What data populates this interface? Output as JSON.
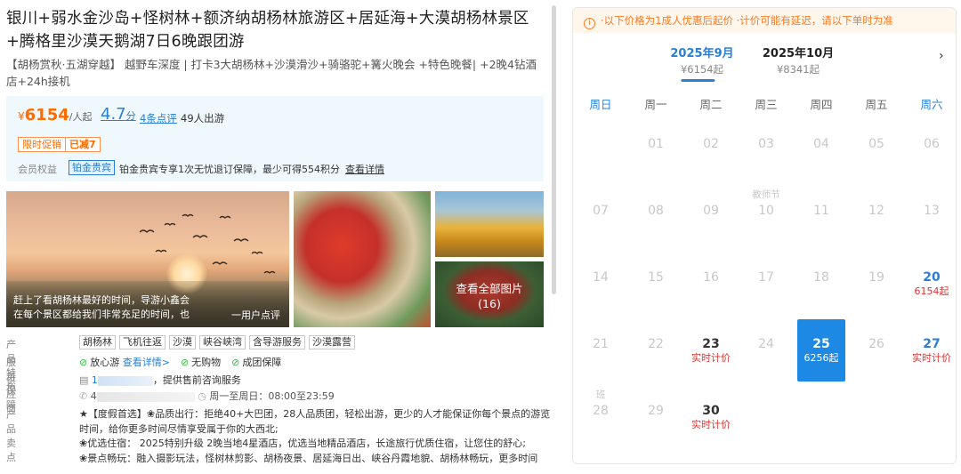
{
  "product": {
    "title": "银川+弱水金沙岛+怪树林+额济纳胡杨林旅游区+居延海+大漠胡杨林景区+腾格里沙漠天鹅湖7日6晚跟团游",
    "subtitle": "【胡杨赏秋·五湖穿越】 越野车深度 | 打卡3大胡杨林+沙漠滑沙+骑骆驼+篝火晚会 +特色晚餐| +2晚4钻酒店+24h接机"
  },
  "price_block": {
    "currency": "¥",
    "price": "6154",
    "price_unit": "/人起",
    "rating": "4.7",
    "rating_unit": "分",
    "reviews": "4条点评",
    "travelers": "49人出游",
    "promo_label": "限时促销",
    "promo_value": "已减7",
    "member_label": "会员权益",
    "member_badge": "铂金贵宾",
    "member_desc": "铂金贵宾专享1次无忧退订保障，最少可得554积分",
    "member_more": "查看详情"
  },
  "gallery": {
    "caption_line1": "赶上了看胡杨林最好的时间，导游小鑫会",
    "caption_line2": "在每个景区都给我们非常充足的时间，也",
    "caption_user": "一用户点评",
    "view_all": "查看全部图片",
    "count": "(16)"
  },
  "info": {
    "features_label": "产品特色",
    "features": [
      "胡杨林",
      "飞机往返",
      "沙漠",
      "峡谷峡湾",
      "含导游服务",
      "沙漠露营"
    ],
    "guarantee_label": "服务保障",
    "guarantee_1": "放心游",
    "guarantee_1_link": "查看详情>",
    "guarantee_2": "无购物",
    "guarantee_3": "成团保障",
    "supplier_label": "供应商",
    "supplier_prefix": "1",
    "supplier_text": "，提供售前咨询服务",
    "phone_prefix": "4",
    "hours": "周一至周日：08:00至23:59",
    "selling_label": "产品卖点",
    "selling_1": "★【度假首选】❀品质出行：拒绝40+大巴团，28人品质团，轻松出游，更少的人才能保证你每个景点的游览时间，给你更多时间尽情享受属于你的大西北;",
    "selling_2": "❀优选住宿： 2025特别升级 2晚当地4星酒店，优选当地精品酒店，长途旅行优质住宿，让您住的舒心;",
    "selling_3": "❀景点畅玩：融入摄影玩法，怪树林剪影、胡杨夜景、居延海日出、峡谷丹霞地貌、胡杨林畅玩，更多时间"
  },
  "calendar": {
    "notice_icon": "i",
    "notice": "·以下价格为1成人优惠后起价 ·计价可能有延迟，请以下单时为准",
    "months": [
      {
        "label": "2025年9月",
        "price": "¥6154起"
      },
      {
        "label": "2025年10月",
        "price": "¥8341起"
      }
    ],
    "next_icon": "›",
    "weekdays": [
      "周日",
      "周一",
      "周二",
      "周三",
      "周四",
      "周五",
      "周六"
    ],
    "days": [
      {
        "d": "",
        "label": "",
        "price": ""
      },
      {
        "d": "01",
        "label": "",
        "price": ""
      },
      {
        "d": "02",
        "label": "",
        "price": ""
      },
      {
        "d": "03",
        "label": "",
        "price": ""
      },
      {
        "d": "04",
        "label": "",
        "price": ""
      },
      {
        "d": "05",
        "label": "",
        "price": ""
      },
      {
        "d": "06",
        "label": "",
        "price": ""
      },
      {
        "d": "07",
        "label": "",
        "price": ""
      },
      {
        "d": "08",
        "label": "",
        "price": ""
      },
      {
        "d": "09",
        "label": "",
        "price": ""
      },
      {
        "d": "10",
        "label": "教师节",
        "price": ""
      },
      {
        "d": "11",
        "label": "",
        "price": ""
      },
      {
        "d": "12",
        "label": "",
        "price": ""
      },
      {
        "d": "13",
        "label": "",
        "price": ""
      },
      {
        "d": "14",
        "label": "",
        "price": ""
      },
      {
        "d": "15",
        "label": "",
        "price": ""
      },
      {
        "d": "16",
        "label": "",
        "price": ""
      },
      {
        "d": "17",
        "label": "",
        "price": ""
      },
      {
        "d": "18",
        "label": "",
        "price": ""
      },
      {
        "d": "19",
        "label": "",
        "price": ""
      },
      {
        "d": "20",
        "label": "",
        "price": "6154起",
        "avail": true
      },
      {
        "d": "21",
        "label": "",
        "price": ""
      },
      {
        "d": "22",
        "label": "",
        "price": ""
      },
      {
        "d": "23",
        "label": "",
        "price": "实时计价",
        "avail": true
      },
      {
        "d": "24",
        "label": "",
        "price": ""
      },
      {
        "d": "25",
        "label": "",
        "price": "6256起",
        "avail": true,
        "selected": true
      },
      {
        "d": "26",
        "label": "",
        "price": ""
      },
      {
        "d": "27",
        "label": "",
        "price": "实时计价",
        "avail": true
      },
      {
        "d": "28",
        "label": "班",
        "price": ""
      },
      {
        "d": "29",
        "label": "",
        "price": ""
      },
      {
        "d": "30",
        "label": "",
        "price": "实时计价",
        "avail": true
      }
    ]
  }
}
